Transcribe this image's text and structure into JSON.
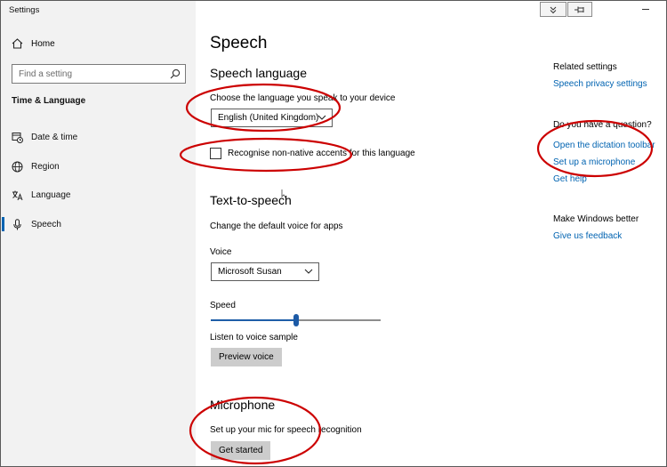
{
  "app": {
    "title": "Settings"
  },
  "titlebar": {
    "minimize_label": "–"
  },
  "sidebar": {
    "home_label": "Home",
    "search_placeholder": "Find a setting",
    "section_title": "Time & Language",
    "items": [
      {
        "label": "Date & time",
        "icon": "calendar-clock-icon"
      },
      {
        "label": "Region",
        "icon": "globe-icon"
      },
      {
        "label": "Language",
        "icon": "language-icon"
      },
      {
        "label": "Speech",
        "icon": "microphone-icon",
        "active": true
      }
    ]
  },
  "main": {
    "title": "Speech",
    "speech_language": {
      "heading": "Speech language",
      "prompt": "Choose the language you speak to your device",
      "selected_language": "English (United Kingdom)",
      "accents_checkbox_label": "Recognise non-native accents for this language",
      "accents_checked": false
    },
    "tts": {
      "heading": "Text-to-speech",
      "description": "Change the default voice for apps",
      "voice_label": "Voice",
      "voice_selected": "Microsoft Susan",
      "speed_label": "Speed",
      "speed_value_fraction": 0.5,
      "sample_label": "Listen to voice sample",
      "preview_button": "Preview voice"
    },
    "microphone": {
      "heading": "Microphone",
      "description": "Set up your mic for speech recognition",
      "get_started_button": "Get started"
    }
  },
  "related": {
    "heading": "Related settings",
    "privacy_link": "Speech privacy settings",
    "question_heading": "Do you have a question?",
    "links": [
      "Open the dictation toolbar",
      "Set up a microphone",
      "Get help"
    ],
    "feedback_heading": "Make Windows better",
    "feedback_link": "Give us feedback"
  },
  "colors": {
    "accent": "#0063b1",
    "annotation": "#cc0000",
    "sidebar_bg": "#f2f2f2",
    "button_bg": "#cccccc"
  }
}
